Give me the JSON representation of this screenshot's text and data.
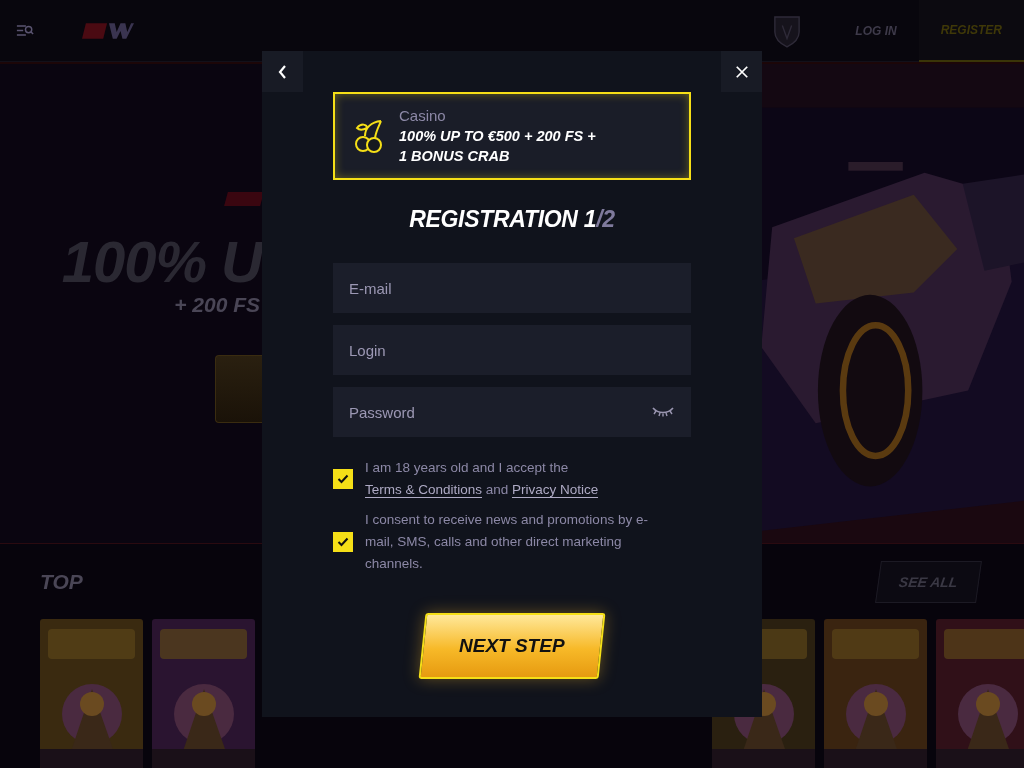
{
  "header": {
    "login": "LOG IN",
    "register": "REGISTER"
  },
  "hero": {
    "headline": "100% U",
    "subline": "+ 200 FS"
  },
  "games": {
    "title": "TOP",
    "see_all": "SEE ALL"
  },
  "modal": {
    "promo": {
      "category": "Casino",
      "offer_lines": [
        "100% UP TO €500 + 200 FS +",
        "1 BONUS CRAB"
      ]
    },
    "title": "REGISTRATION 1",
    "step_total": "/2",
    "fields": [
      {
        "placeholder": "E-mail",
        "kind": "text"
      },
      {
        "placeholder": "Login",
        "kind": "text"
      },
      {
        "placeholder": "Password",
        "kind": "password"
      }
    ],
    "consents": [
      {
        "checked": true,
        "parts": [
          {
            "kind": "text",
            "text": "I am 18 years old and I accept the "
          },
          {
            "kind": "link",
            "text": "Terms & Conditions"
          },
          {
            "kind": "text",
            "text": " and "
          },
          {
            "kind": "link",
            "text": "Privacy Notice"
          }
        ]
      },
      {
        "checked": true,
        "parts": [
          {
            "kind": "text",
            "text": "I consent to receive news and promotions by e-mail, SMS, calls and other direct marketing channels."
          }
        ]
      }
    ],
    "button": "NEXT STEP"
  }
}
